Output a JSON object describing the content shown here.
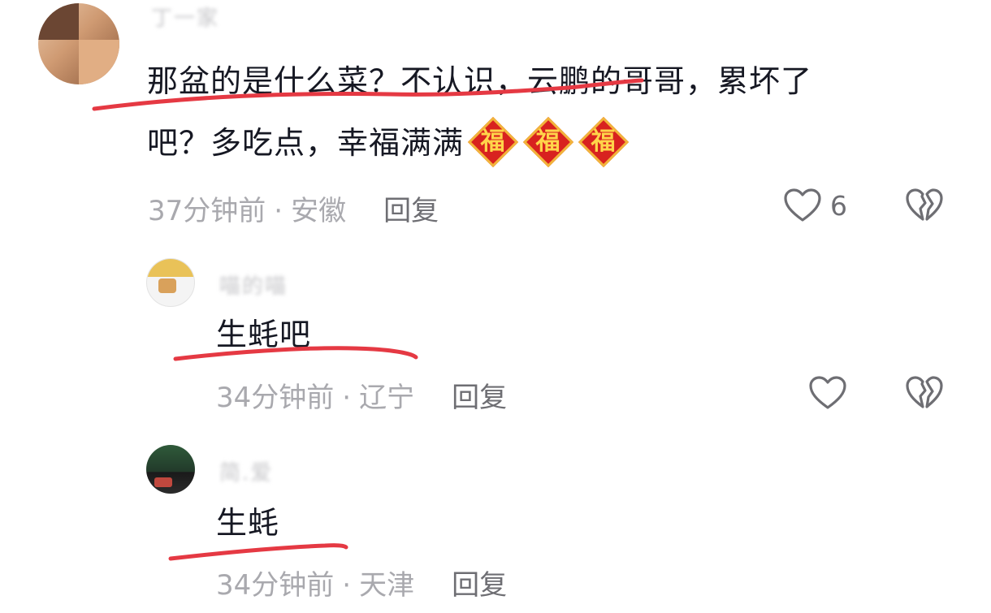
{
  "comments": [
    {
      "username": "丁一家",
      "text_line1": "那盆的是什么菜？不认识，云鹏的哥哥，累坏了",
      "text_line2": "吧？多吃点，幸福满满",
      "emoji_char": "福",
      "time": "37分钟前",
      "location": "安徽",
      "reply_label": "回复",
      "likes": "6"
    },
    {
      "username": "喵的喵",
      "text": "生蚝吧",
      "time": "34分钟前",
      "location": "辽宁",
      "reply_label": "回复"
    },
    {
      "username": "简.爱",
      "text": "生蚝",
      "time": "34分钟前",
      "location": "天津",
      "reply_label": "回复"
    }
  ],
  "separator": "·",
  "colors": {
    "underline": "#e53943",
    "meta": "#a9a9ae",
    "text": "#161823",
    "fu_bg": "#d8221f",
    "fu_border": "#f2b43a"
  },
  "icons": {
    "like": "heart-outline-icon",
    "dislike": "broken-heart-icon",
    "emoji": "fu-emoji-icon"
  }
}
